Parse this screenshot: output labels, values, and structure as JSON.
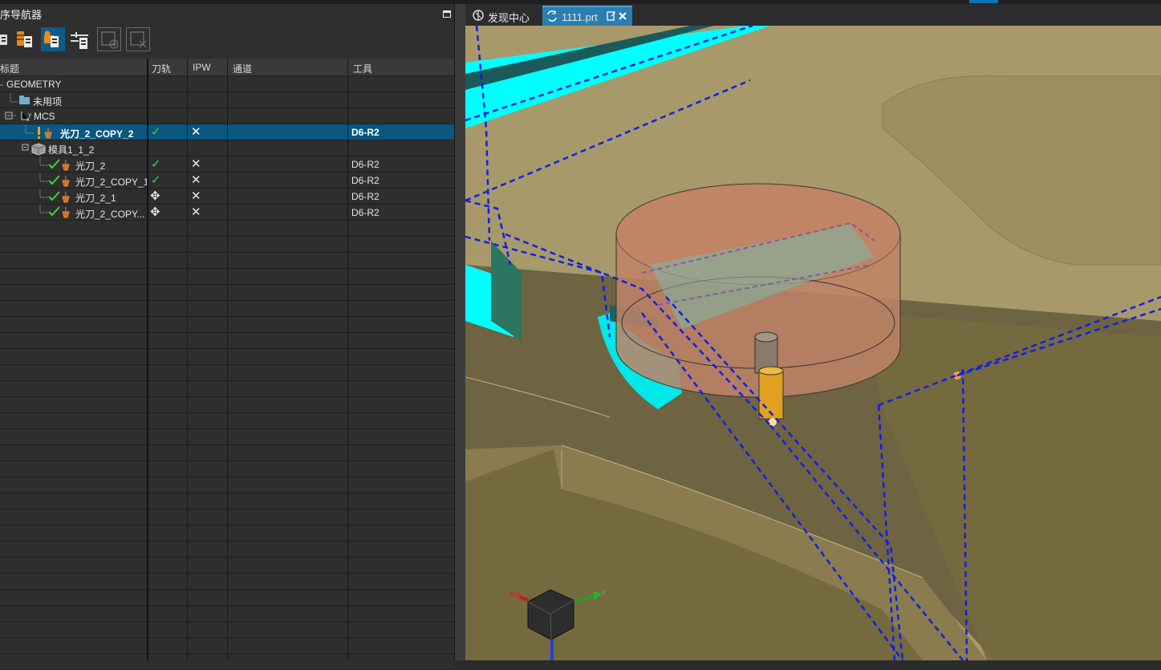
{
  "navigator": {
    "title": "序导航器",
    "toolbar": [
      "program-order-icon",
      "machine-tool-icon",
      "geometry-view-icon",
      "machining-method-icon",
      "add-icon",
      "remove-icon"
    ]
  },
  "columns": {
    "name": "标题",
    "toolpath": "刀轨",
    "ipw": "IPW",
    "channel": "通道",
    "tool": "工具"
  },
  "rows": [
    {
      "name": "GEOMETRY",
      "toolpath": "",
      "ipw": "",
      "tool": ""
    },
    {
      "name": "未用项",
      "toolpath": "",
      "ipw": "",
      "tool": ""
    },
    {
      "name": "MCS",
      "toolpath": "",
      "ipw": "",
      "tool": ""
    },
    {
      "name": "光刀_2_COPY_2",
      "toolpath": "✓",
      "ipw": "✕",
      "tool": "D6-R2"
    },
    {
      "name": "模具1_1_2",
      "toolpath": "",
      "ipw": "",
      "tool": ""
    },
    {
      "name": "光刀_2",
      "toolpath": "✓",
      "ipw": "✕",
      "tool": "D6-R2"
    },
    {
      "name": "光刀_2_COPY_1",
      "toolpath": "✓",
      "ipw": "✕",
      "tool": "D6-R2"
    },
    {
      "name": "光刀_2_1",
      "toolpath": "✥",
      "ipw": "✕",
      "tool": "D6-R2"
    },
    {
      "name": "光刀_2_COPY...",
      "toolpath": "✥",
      "ipw": "✕",
      "tool": "D6-R2"
    }
  ],
  "tabs": [
    {
      "label": "发现中心",
      "icon": "discovery-icon"
    },
    {
      "label": "1111.prt",
      "icon": "part-file-icon"
    }
  ],
  "triad": {
    "x": "X",
    "y": "Y"
  },
  "colors": {
    "selection": "#0a5780",
    "tab_active": "#2a7fb0",
    "check": "#3fd13f",
    "toolpath": "#1020e0",
    "cyan": "#00ffff"
  }
}
